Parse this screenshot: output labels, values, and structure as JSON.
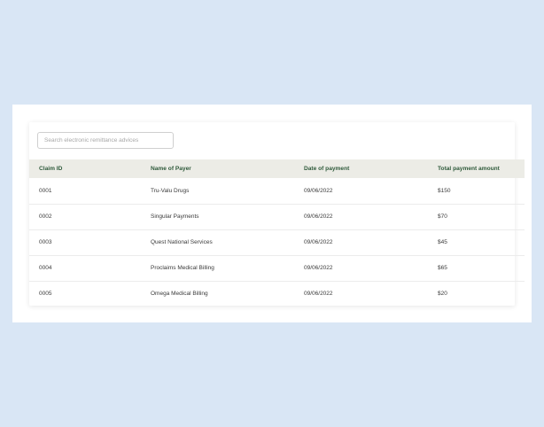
{
  "search": {
    "placeholder": "Search electronic remittance advices"
  },
  "table": {
    "headers": [
      "Claim ID",
      "Name of Payer",
      "Date of payment",
      "Total payment amount"
    ],
    "rows": [
      [
        "0001",
        "Tru-Valu Drugs",
        "09/06/2022",
        "$150"
      ],
      [
        "0002",
        "Singular Payments",
        "09/06/2022",
        "$70"
      ],
      [
        "0003",
        "Quest National Services",
        "09/06/2022",
        "$45"
      ],
      [
        "0004",
        "Proclaims Medical Billing",
        "09/06/2022",
        "$65"
      ],
      [
        "0005",
        "Omega Medical Billing",
        "09/06/2022",
        "$20"
      ]
    ]
  },
  "colors": {
    "background": "#d9e6f5",
    "header_bg": "#ecece6",
    "header_text": "#2f5a3b"
  }
}
